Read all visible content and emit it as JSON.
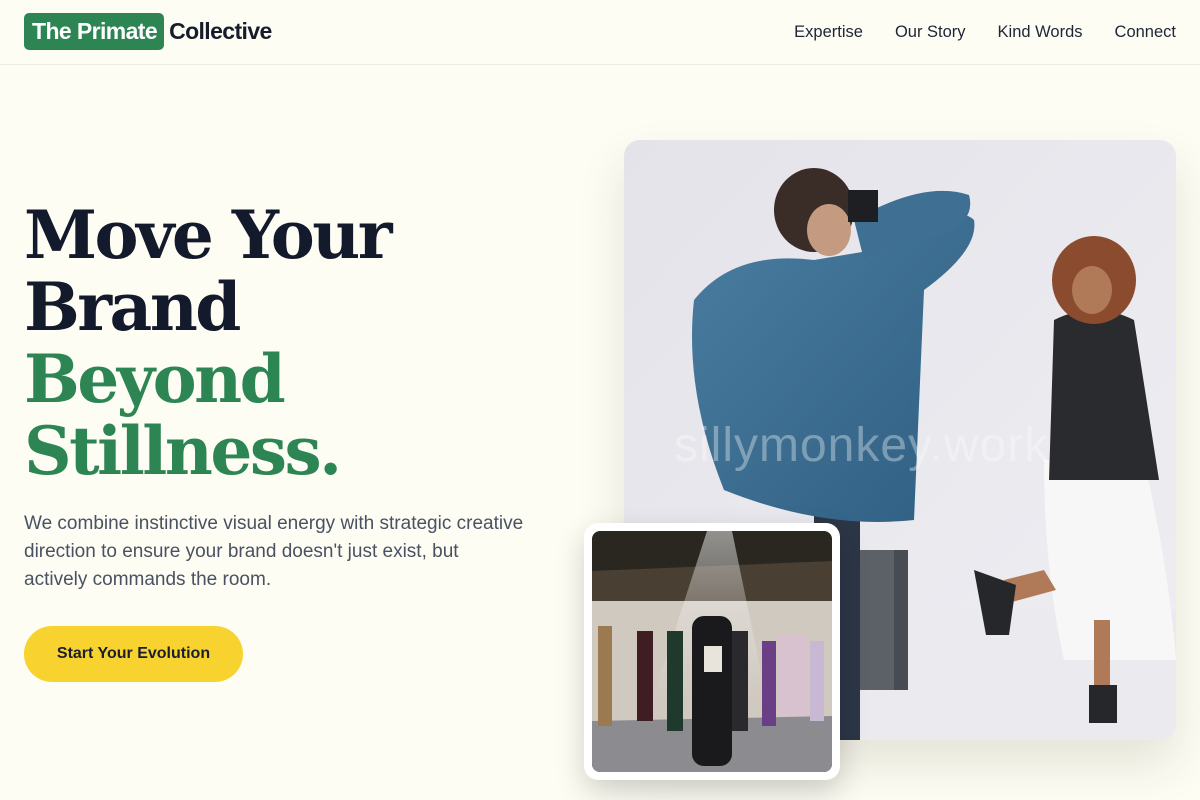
{
  "header": {
    "logo_highlight": "The Primate",
    "logo_rest": "Collective",
    "nav": [
      {
        "label": "Expertise"
      },
      {
        "label": "Our Story"
      },
      {
        "label": "Kind Words"
      },
      {
        "label": "Connect"
      }
    ]
  },
  "hero": {
    "headline_lines": [
      "Move Your",
      "Brand"
    ],
    "headline_accent_lines": [
      "Beyond",
      "Stillness."
    ],
    "subtext": "We combine instinctive visual energy with strategic creative direction to ensure your brand doesn't just exist, but actively commands the room.",
    "cta_label": "Start Your Evolution"
  },
  "images": {
    "main_watermark": "sillymonkey.work"
  },
  "colors": {
    "brand_green": "#2e8554",
    "cta_yellow": "#f8d22e",
    "background": "#fdfdf4",
    "headline_dark": "#131a2b"
  }
}
